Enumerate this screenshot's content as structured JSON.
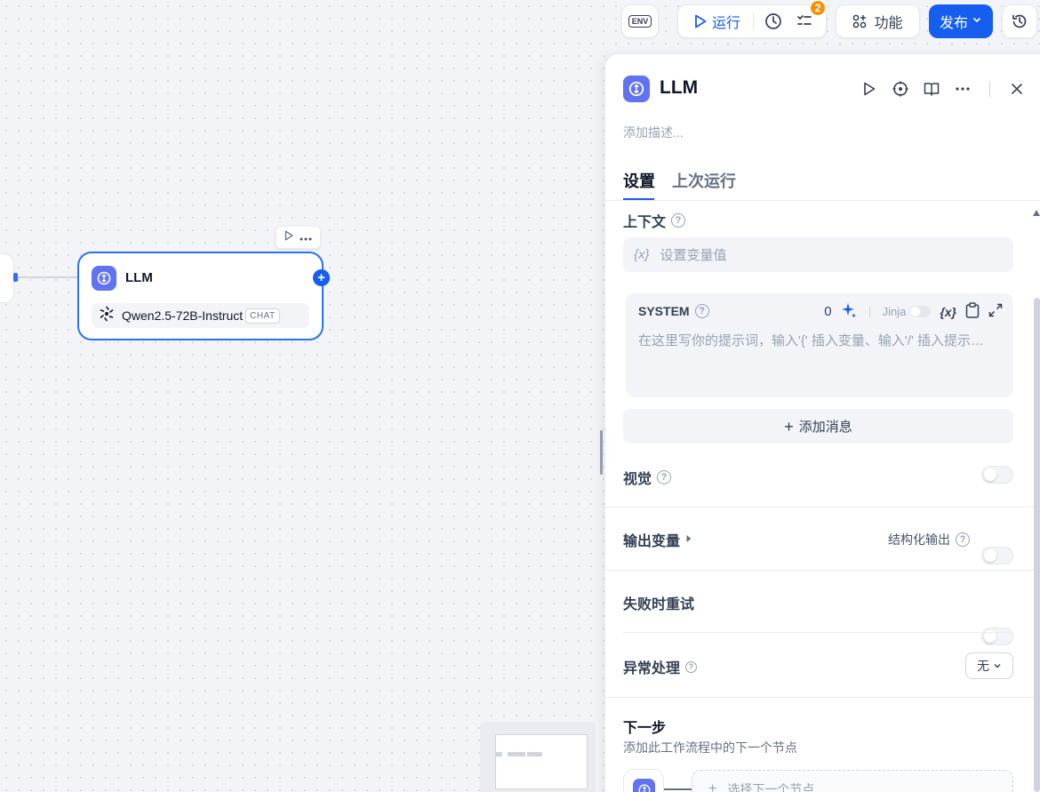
{
  "toolbar": {
    "env_label": "ENV",
    "run_label": "运行",
    "badge_count": "2",
    "features_label": "功能",
    "publish_label": "发布"
  },
  "canvas": {
    "node": {
      "title": "LLM",
      "model_name": "Qwen2.5-72B-Instruct",
      "model_mode": "CHAT"
    }
  },
  "panel": {
    "title": "LLM",
    "description_placeholder": "添加描述...",
    "tabs": [
      {
        "label": "设置",
        "active": true
      },
      {
        "label": "上次运行",
        "active": false
      }
    ],
    "context": {
      "label": "上下文",
      "var_icon": "{x}",
      "placeholder": "设置变量值"
    },
    "system": {
      "label": "SYSTEM",
      "token_count": "0",
      "jinja_label": "Jinja",
      "var_icon": "{x}",
      "placeholder": "在这里写你的提示词，输入'{' 插入变量、输入'/' 插入提示内容块"
    },
    "add_message_label": "添加消息",
    "vision_label": "视觉",
    "output_vars_label": "输出变量",
    "structured_output_label": "结构化输出",
    "retry_label": "失败时重试",
    "error_handling": {
      "label": "异常处理",
      "value": "无"
    },
    "next_step": {
      "title": "下一步",
      "description": "添加此工作流程中的下一个节点",
      "select_placeholder": "选择下一个节点"
    }
  },
  "colors": {
    "accent": "#155eef",
    "node_icon_bg": "#6172f3",
    "badge": "#f79009"
  }
}
